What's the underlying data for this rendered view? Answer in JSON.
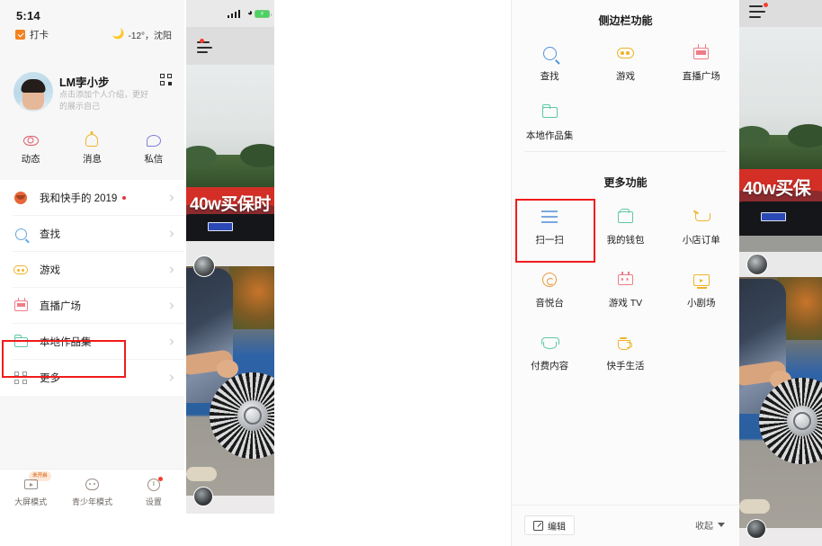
{
  "left_phone": {
    "status_bar": {
      "time": "5:14"
    },
    "checkin": {
      "label": "打卡",
      "icon": "checkin-icon"
    },
    "weather": {
      "icon": "moon-icon",
      "text": "-12°，沈阳"
    },
    "profile": {
      "name": "LM孛小步",
      "bio": "点击添加个人介绍，更好的展示自己",
      "qr_icon": "qr-code-icon",
      "avatar": "avatar"
    },
    "actions": [
      {
        "label": "动态",
        "icon": "eye-icon"
      },
      {
        "label": "消息",
        "icon": "bell-icon"
      },
      {
        "label": "私信",
        "icon": "chat-bubble-icon"
      }
    ],
    "menu": [
      {
        "label": "我和快手的 2019",
        "icon": "kuaishou-2019-icon",
        "dot": true
      },
      {
        "label": "查找",
        "icon": "search-icon",
        "dot": false
      },
      {
        "label": "游戏",
        "icon": "game-icon",
        "dot": false
      },
      {
        "label": "直播广场",
        "icon": "live-icon",
        "dot": false
      },
      {
        "label": "本地作品集",
        "icon": "folder-icon",
        "dot": false
      },
      {
        "label": "更多",
        "icon": "grid-more-icon",
        "dot": false,
        "highlighted": true
      }
    ],
    "bottom_bar": [
      {
        "label": "大屏模式",
        "icon": "tv-icon",
        "badge": "未开启"
      },
      {
        "label": "青少年模式",
        "icon": "teen-mode-icon",
        "badge": ""
      },
      {
        "label": "设置",
        "icon": "settings-icon",
        "badge": "",
        "dot": true
      }
    ]
  },
  "video_strip": {
    "menu_icon": "hamburger-menu-icon",
    "banner_text": "40w买保时",
    "status_icons": [
      "signal-icon",
      "wifi-icon",
      "battery-icon"
    ]
  },
  "video_strip_right": {
    "menu_icon": "hamburger-menu-icon",
    "banner_text": "40w买保"
  },
  "right_panel": {
    "section1": {
      "title": "侧边栏功能",
      "items": [
        {
          "label": "查找",
          "icon": "search-icon"
        },
        {
          "label": "游戏",
          "icon": "game-icon"
        },
        {
          "label": "直播广场",
          "icon": "live-icon"
        },
        {
          "label": "本地作品集",
          "icon": "folder-icon"
        }
      ]
    },
    "section2": {
      "title": "更多功能",
      "items": [
        {
          "label": "扫一扫",
          "icon": "scan-icon",
          "highlighted": true
        },
        {
          "label": "我的钱包",
          "icon": "wallet-icon"
        },
        {
          "label": "小店订单",
          "icon": "cart-icon"
        },
        {
          "label": "音悦台",
          "icon": "music-icon"
        },
        {
          "label": "游戏 TV",
          "icon": "game-tv-icon"
        },
        {
          "label": "小剧场",
          "icon": "stage-icon"
        },
        {
          "label": "付费内容",
          "icon": "gem-icon"
        },
        {
          "label": "快手生活",
          "icon": "coffee-cup-icon"
        }
      ]
    },
    "bottom": {
      "edit_label": "编辑",
      "edit_icon": "edit-icon",
      "collapse_label": "收起",
      "collapse_icon": "caret-down-icon"
    }
  },
  "colors": {
    "highlight_red": "#f21b1b",
    "accent_orange": "#f58220",
    "panel_bg": "#fbfbfb",
    "sidebar_bg": "#f7f7f7"
  }
}
